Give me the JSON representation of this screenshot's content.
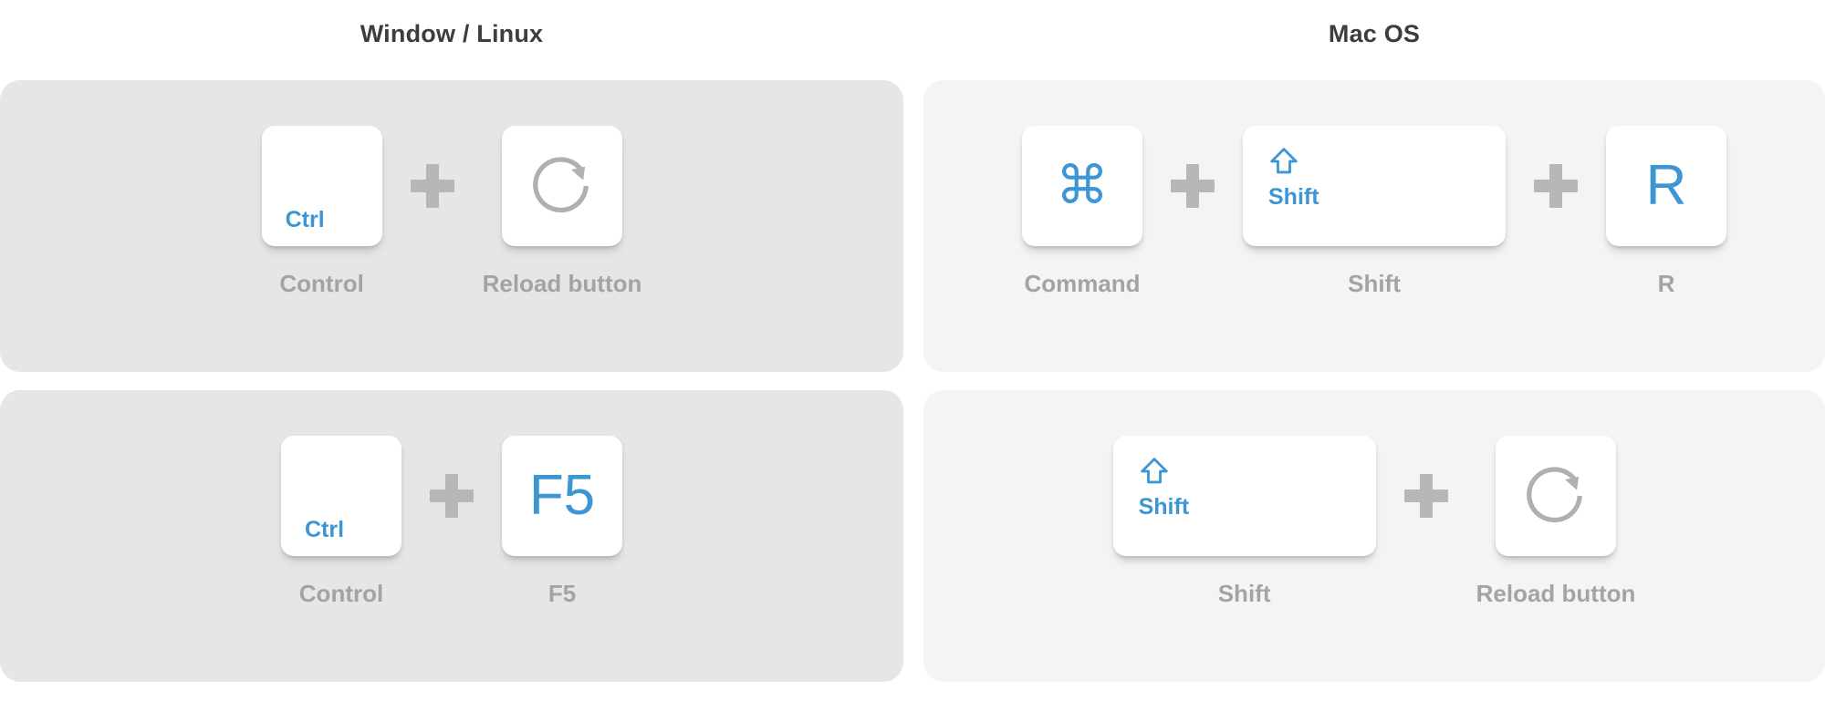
{
  "columns": [
    {
      "title": "Window / Linux",
      "panel_color": "#e6e6e6"
    },
    {
      "title": "Mac OS",
      "panel_color": "#f4f4f4"
    }
  ],
  "accent_color": "#3d96d4",
  "caption_color": "#a3a3a3",
  "plus_color": "#b7b7b7",
  "plus_symbol": "+",
  "rows": [
    {
      "win": {
        "keys": [
          {
            "key_label": "Ctrl",
            "caption": "Control",
            "icon": "none",
            "width": "narrow",
            "label_pos": "corner"
          },
          {
            "key_label": "",
            "caption": "Reload button",
            "icon": "reload-icon",
            "width": "narrow",
            "label_pos": "center"
          }
        ]
      },
      "mac": {
        "keys": [
          {
            "key_label": "",
            "caption": "Command",
            "icon": "command-icon",
            "width": "narrow",
            "label_pos": "center"
          },
          {
            "key_label": "Shift",
            "caption": "Shift",
            "icon": "shift-arrow-icon",
            "width": "wide",
            "label_pos": "topleft"
          },
          {
            "key_label": "R",
            "caption": "R",
            "icon": "none",
            "width": "narrow",
            "label_pos": "center"
          }
        ]
      }
    },
    {
      "win": {
        "keys": [
          {
            "key_label": "Ctrl",
            "caption": "Control",
            "icon": "none",
            "width": "narrow",
            "label_pos": "corner"
          },
          {
            "key_label": "F5",
            "caption": "F5",
            "icon": "none",
            "width": "narrow",
            "label_pos": "center"
          }
        ]
      },
      "mac": {
        "keys": [
          {
            "key_label": "Shift",
            "caption": "Shift",
            "icon": "shift-arrow-icon",
            "width": "wide",
            "label_pos": "topleft"
          },
          {
            "key_label": "",
            "caption": "Reload button",
            "icon": "reload-icon",
            "width": "narrow",
            "label_pos": "center"
          }
        ]
      }
    }
  ]
}
